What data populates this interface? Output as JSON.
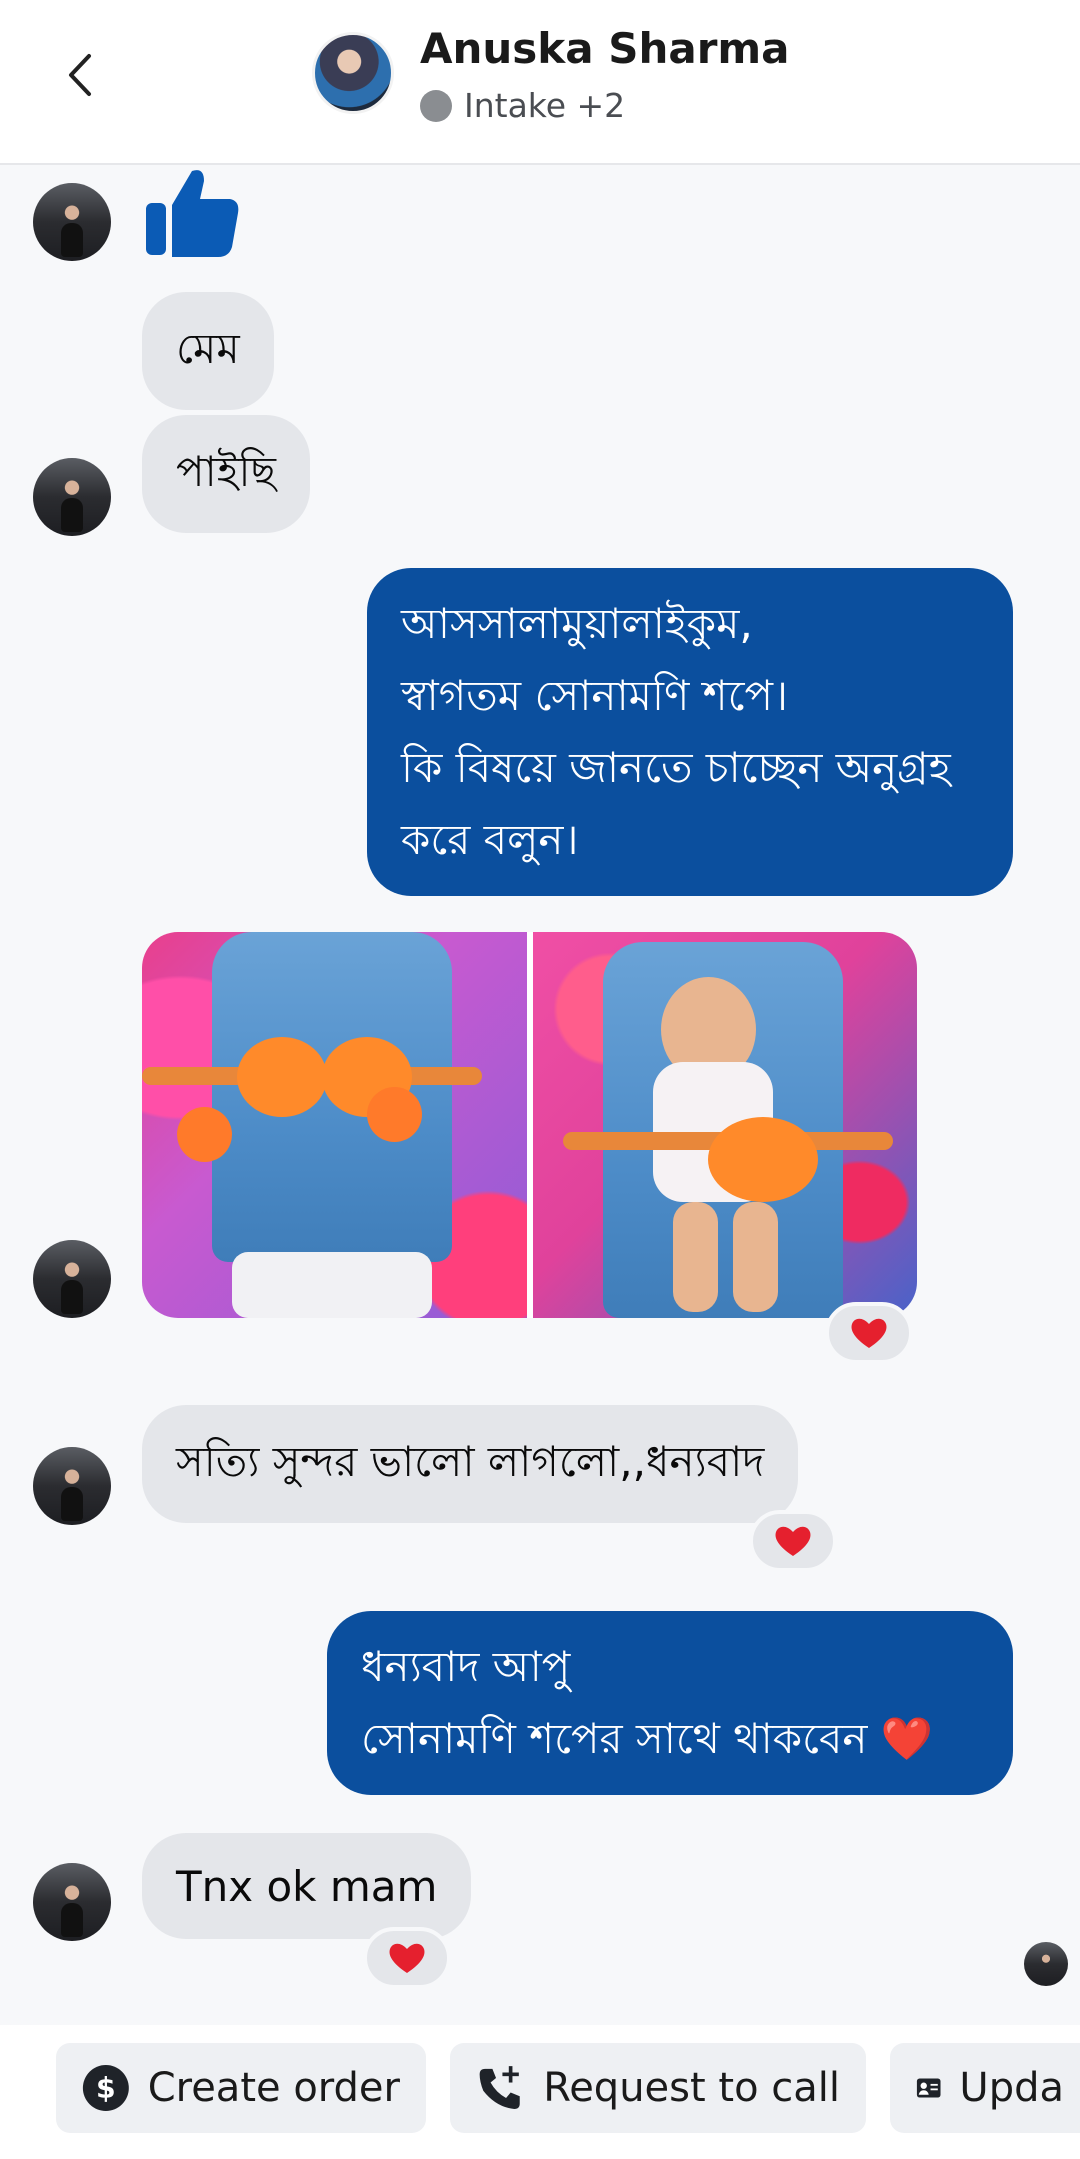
{
  "header": {
    "name": "Anuska Sharma",
    "status": "Intake +2"
  },
  "messages": {
    "in_1": "মেম",
    "in_2": "পাইছি",
    "out_1": [
      "আসসালামুয়ালাইকুম,",
      "স্বাগতম সোনামণি শপে।",
      "কি বিষয়ে জানতে চাচ্ছেন অনুগ্রহ",
      "করে বলুন।"
    ],
    "in_3": "সত্যি সুন্দর ভালো লাগলো,,ধন্যবাদ",
    "out_2": [
      "ধন্যবাদ আপু",
      "সোনামণি শপের সাথে থাকবেন ❤️"
    ],
    "in_4": "Tnx ok mam"
  },
  "actions": {
    "create_order": "Create order",
    "request_call": "Request to call",
    "update": "Upda"
  },
  "colors": {
    "outgoing": "#0b4f9e",
    "incoming": "#e4e6ea",
    "like": "#0b5bb5",
    "heart": "#e5202e"
  }
}
